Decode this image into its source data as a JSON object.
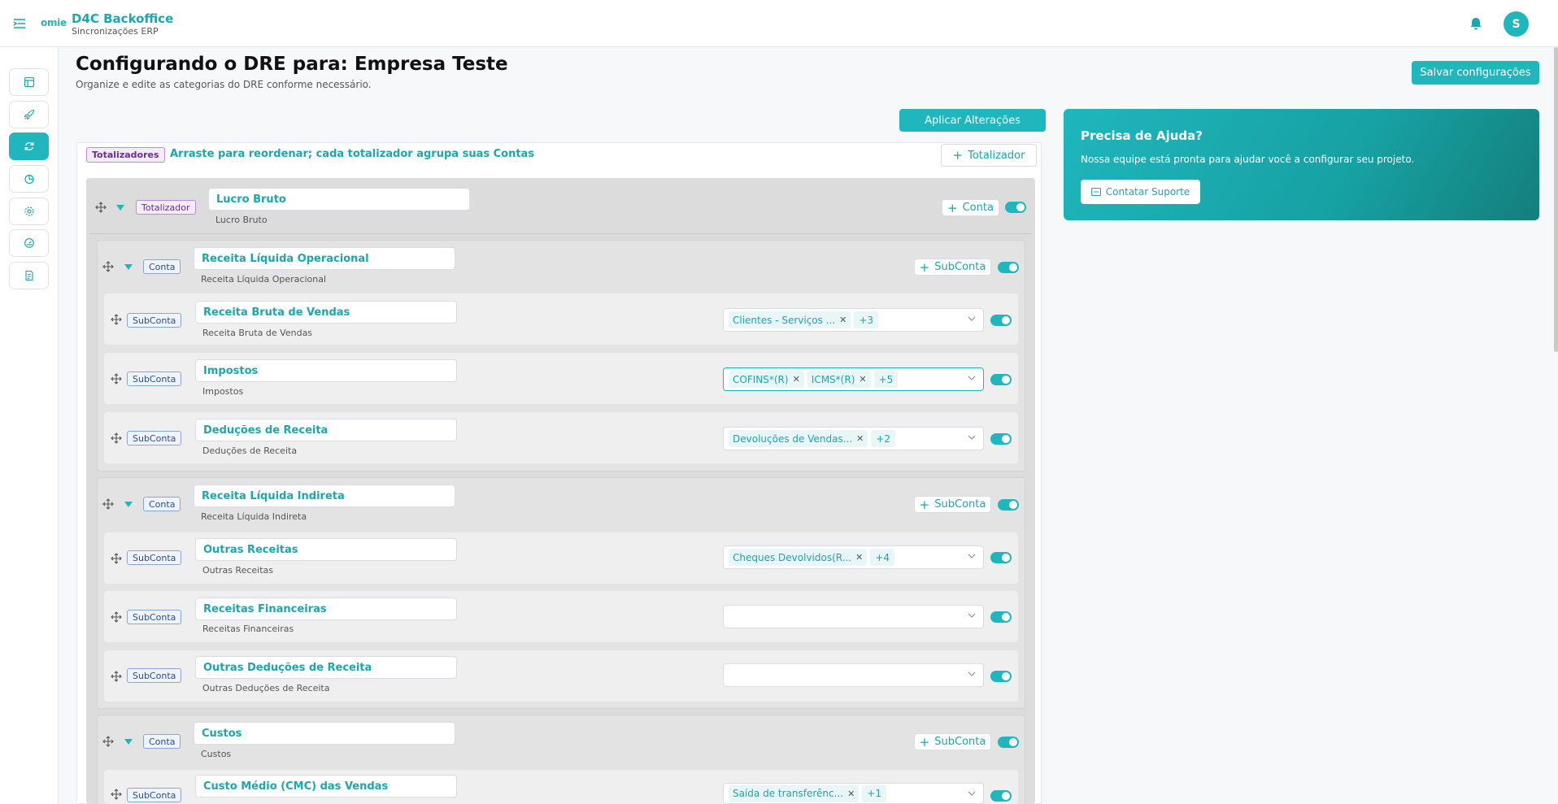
{
  "header": {
    "logo_text": "omie",
    "app_title": "D4C Backoffice",
    "app_subtitle": "Sincronizações ERP",
    "avatar_initial": "S"
  },
  "page": {
    "title": "Configurando o DRE para: Empresa Teste",
    "subtitle": "Organize e edite as categorias do DRE conforme necessário.",
    "save_label": "Salvar configurações",
    "apply_label": "Aplicar Alterações"
  },
  "panel": {
    "badge": "Totalizadores",
    "hint": "Arraste para reordenar; cada totalizador agrupa suas Contas",
    "add_totalizer_label": "Totalizador"
  },
  "totalizer": {
    "tag": "Totalizador",
    "name": "Lucro Bruto",
    "sub": "Lucro Bruto",
    "add_label": "Conta",
    "enabled": true
  },
  "contas": [
    {
      "tag": "Conta",
      "name": "Receita Líquida Operacional",
      "sub": "Receita Líquida Operacional",
      "add_label": "SubConta",
      "subcontas": [
        {
          "tag": "SubConta",
          "name": "Receita Bruta de Vendas",
          "sub": "Receita Bruta de Vendas",
          "chips": [
            "Clientes - Serviços ..."
          ],
          "more": "+3"
        },
        {
          "tag": "SubConta",
          "name": "Impostos",
          "sub": "Impostos",
          "chips": [
            "COFINS*(R)",
            "ICMS*(R)"
          ],
          "more": "+5"
        },
        {
          "tag": "SubConta",
          "name": "Deduções de Receita",
          "sub": "Deduções de Receita",
          "chips": [
            "Devoluções de Vendas..."
          ],
          "more": "+2"
        }
      ]
    },
    {
      "tag": "Conta",
      "name": "Receita Líquida Indireta",
      "sub": "Receita Líquida Indireta",
      "add_label": "SubConta",
      "subcontas": [
        {
          "tag": "SubConta",
          "name": "Outras Receitas",
          "sub": "Outras Receitas",
          "chips": [
            "Cheques Devolvidos(R..."
          ],
          "more": "+4"
        },
        {
          "tag": "SubConta",
          "name": "Receitas Financeiras",
          "sub": "Receitas Financeiras",
          "chips": [],
          "more": ""
        },
        {
          "tag": "SubConta",
          "name": "Outras Deduções de Receita",
          "sub": "Outras Deduções de Receita",
          "chips": [],
          "more": ""
        }
      ]
    },
    {
      "tag": "Conta",
      "name": "Custos",
      "sub": "Custos",
      "add_label": "SubConta",
      "subcontas": [
        {
          "tag": "SubConta",
          "name": "Custo Médio (CMC) das Vendas",
          "sub": "",
          "chips": [
            "Saída de transferênc..."
          ],
          "more": "+1"
        }
      ]
    }
  ],
  "help": {
    "title": "Precisa de Ajuda?",
    "text": "Nossa equipe está pronta para ajudar você a configurar seu projeto.",
    "button_label": "Contatar Suporte"
  },
  "colors": {
    "accent": "#1fb6bd",
    "accent_dark": "#137f7c"
  },
  "sidebar_icons": [
    "dashboard-icon",
    "rocket-icon",
    "sync-icon",
    "chart-pie-icon",
    "gear-icon",
    "gauge-icon",
    "report-icon"
  ]
}
